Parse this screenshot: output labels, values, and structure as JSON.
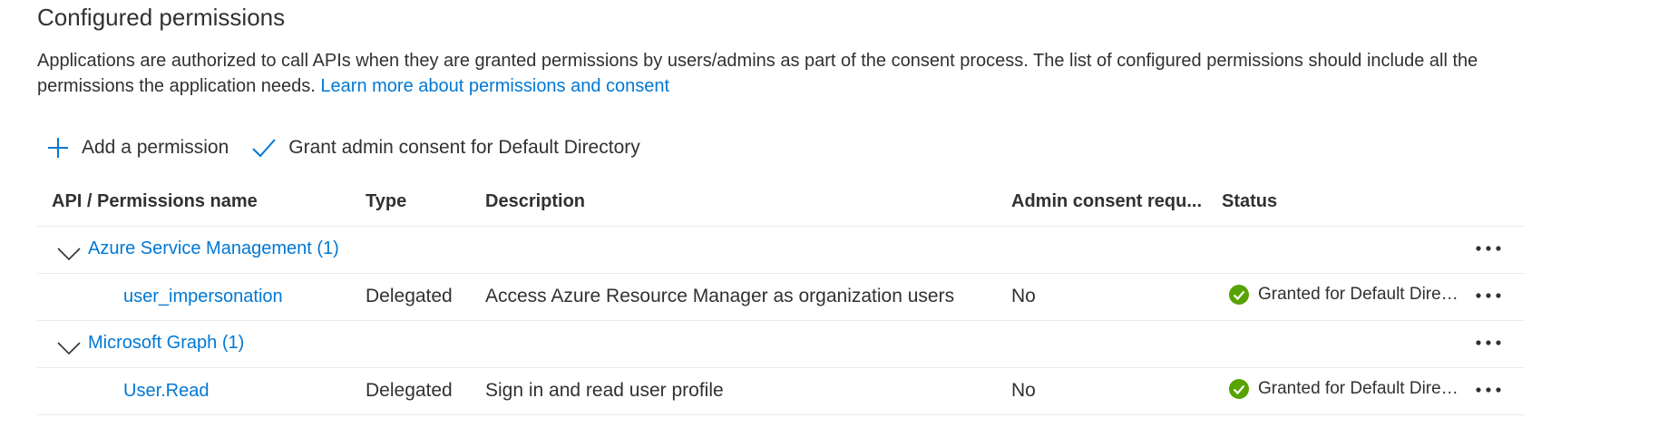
{
  "section": {
    "title": "Configured permissions",
    "description": "Applications are authorized to call APIs when they are granted permissions by users/admins as part of the consent process. The list of configured permissions should include all the permissions the application needs.",
    "learn_more_link": "Learn more about permissions and consent"
  },
  "toolbar": {
    "add_permission_label": "Add a permission",
    "grant_consent_label": "Grant admin consent for Default Directory"
  },
  "table": {
    "headers": {
      "name": "API / Permissions name",
      "type": "Type",
      "description": "Description",
      "admin_consent": "Admin consent requ...",
      "status": "Status"
    },
    "groups": [
      {
        "label": "Azure Service Management (1)",
        "permissions": [
          {
            "name": "user_impersonation",
            "type": "Delegated",
            "description": "Access Azure Resource Manager as organization users",
            "admin_consent": "No",
            "status": "Granted for Default Directory"
          }
        ]
      },
      {
        "label": "Microsoft Graph (1)",
        "permissions": [
          {
            "name": "User.Read",
            "type": "Delegated",
            "description": "Sign in and read user profile",
            "admin_consent": "No",
            "status": "Granted for Default Directory"
          }
        ]
      }
    ]
  },
  "colors": {
    "accent": "#0078d4",
    "success": "#57a300",
    "text": "#323130",
    "border": "#edebe9"
  },
  "icons": {
    "add": "plus-icon",
    "grant": "checkmark-icon",
    "expand": "chevron-down-icon",
    "more": "more-icon",
    "status": "success-check-icon"
  }
}
